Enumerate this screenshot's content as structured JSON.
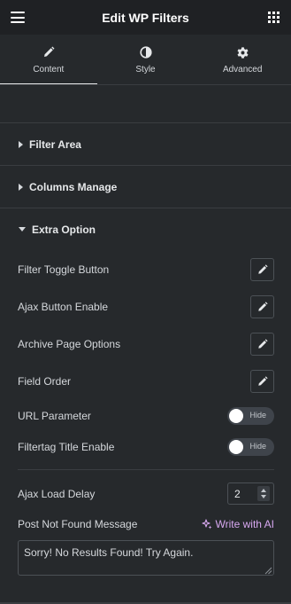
{
  "header": {
    "title": "Edit WP Filters",
    "menu_icon": "hamburger-icon",
    "apps_icon": "grid-icon"
  },
  "tabs": [
    {
      "label": "Content",
      "icon": "pencil-icon",
      "active": true
    },
    {
      "label": "Style",
      "icon": "half-circle-icon",
      "active": false
    },
    {
      "label": "Advanced",
      "icon": "gear-icon",
      "active": false
    }
  ],
  "sections": {
    "filter_area": {
      "title": "Filter Area",
      "expanded": false
    },
    "columns_manage": {
      "title": "Columns Manage",
      "expanded": false
    },
    "extra_option": {
      "title": "Extra Option",
      "expanded": true
    }
  },
  "extra_option": {
    "filter_toggle_button": {
      "label": "Filter Toggle Button"
    },
    "ajax_button_enable": {
      "label": "Ajax Button Enable"
    },
    "archive_page_options": {
      "label": "Archive Page Options"
    },
    "field_order": {
      "label": "Field Order"
    },
    "url_parameter": {
      "label": "URL Parameter",
      "toggle_text": "Hide",
      "enabled": false
    },
    "filtertag_title_enable": {
      "label": "Filtertag Title Enable",
      "toggle_text": "Hide",
      "enabled": false
    },
    "ajax_load_delay": {
      "label": "Ajax Load Delay",
      "value": "2"
    },
    "post_not_found_message": {
      "label": "Post Not Found Message",
      "ai_link": "Write with AI",
      "value": "Sorry! No Results Found! Try Again."
    }
  },
  "colors": {
    "panel_bg": "#26292c",
    "header_bg": "#1f2124",
    "ai_accent": "#d7a8f0"
  }
}
